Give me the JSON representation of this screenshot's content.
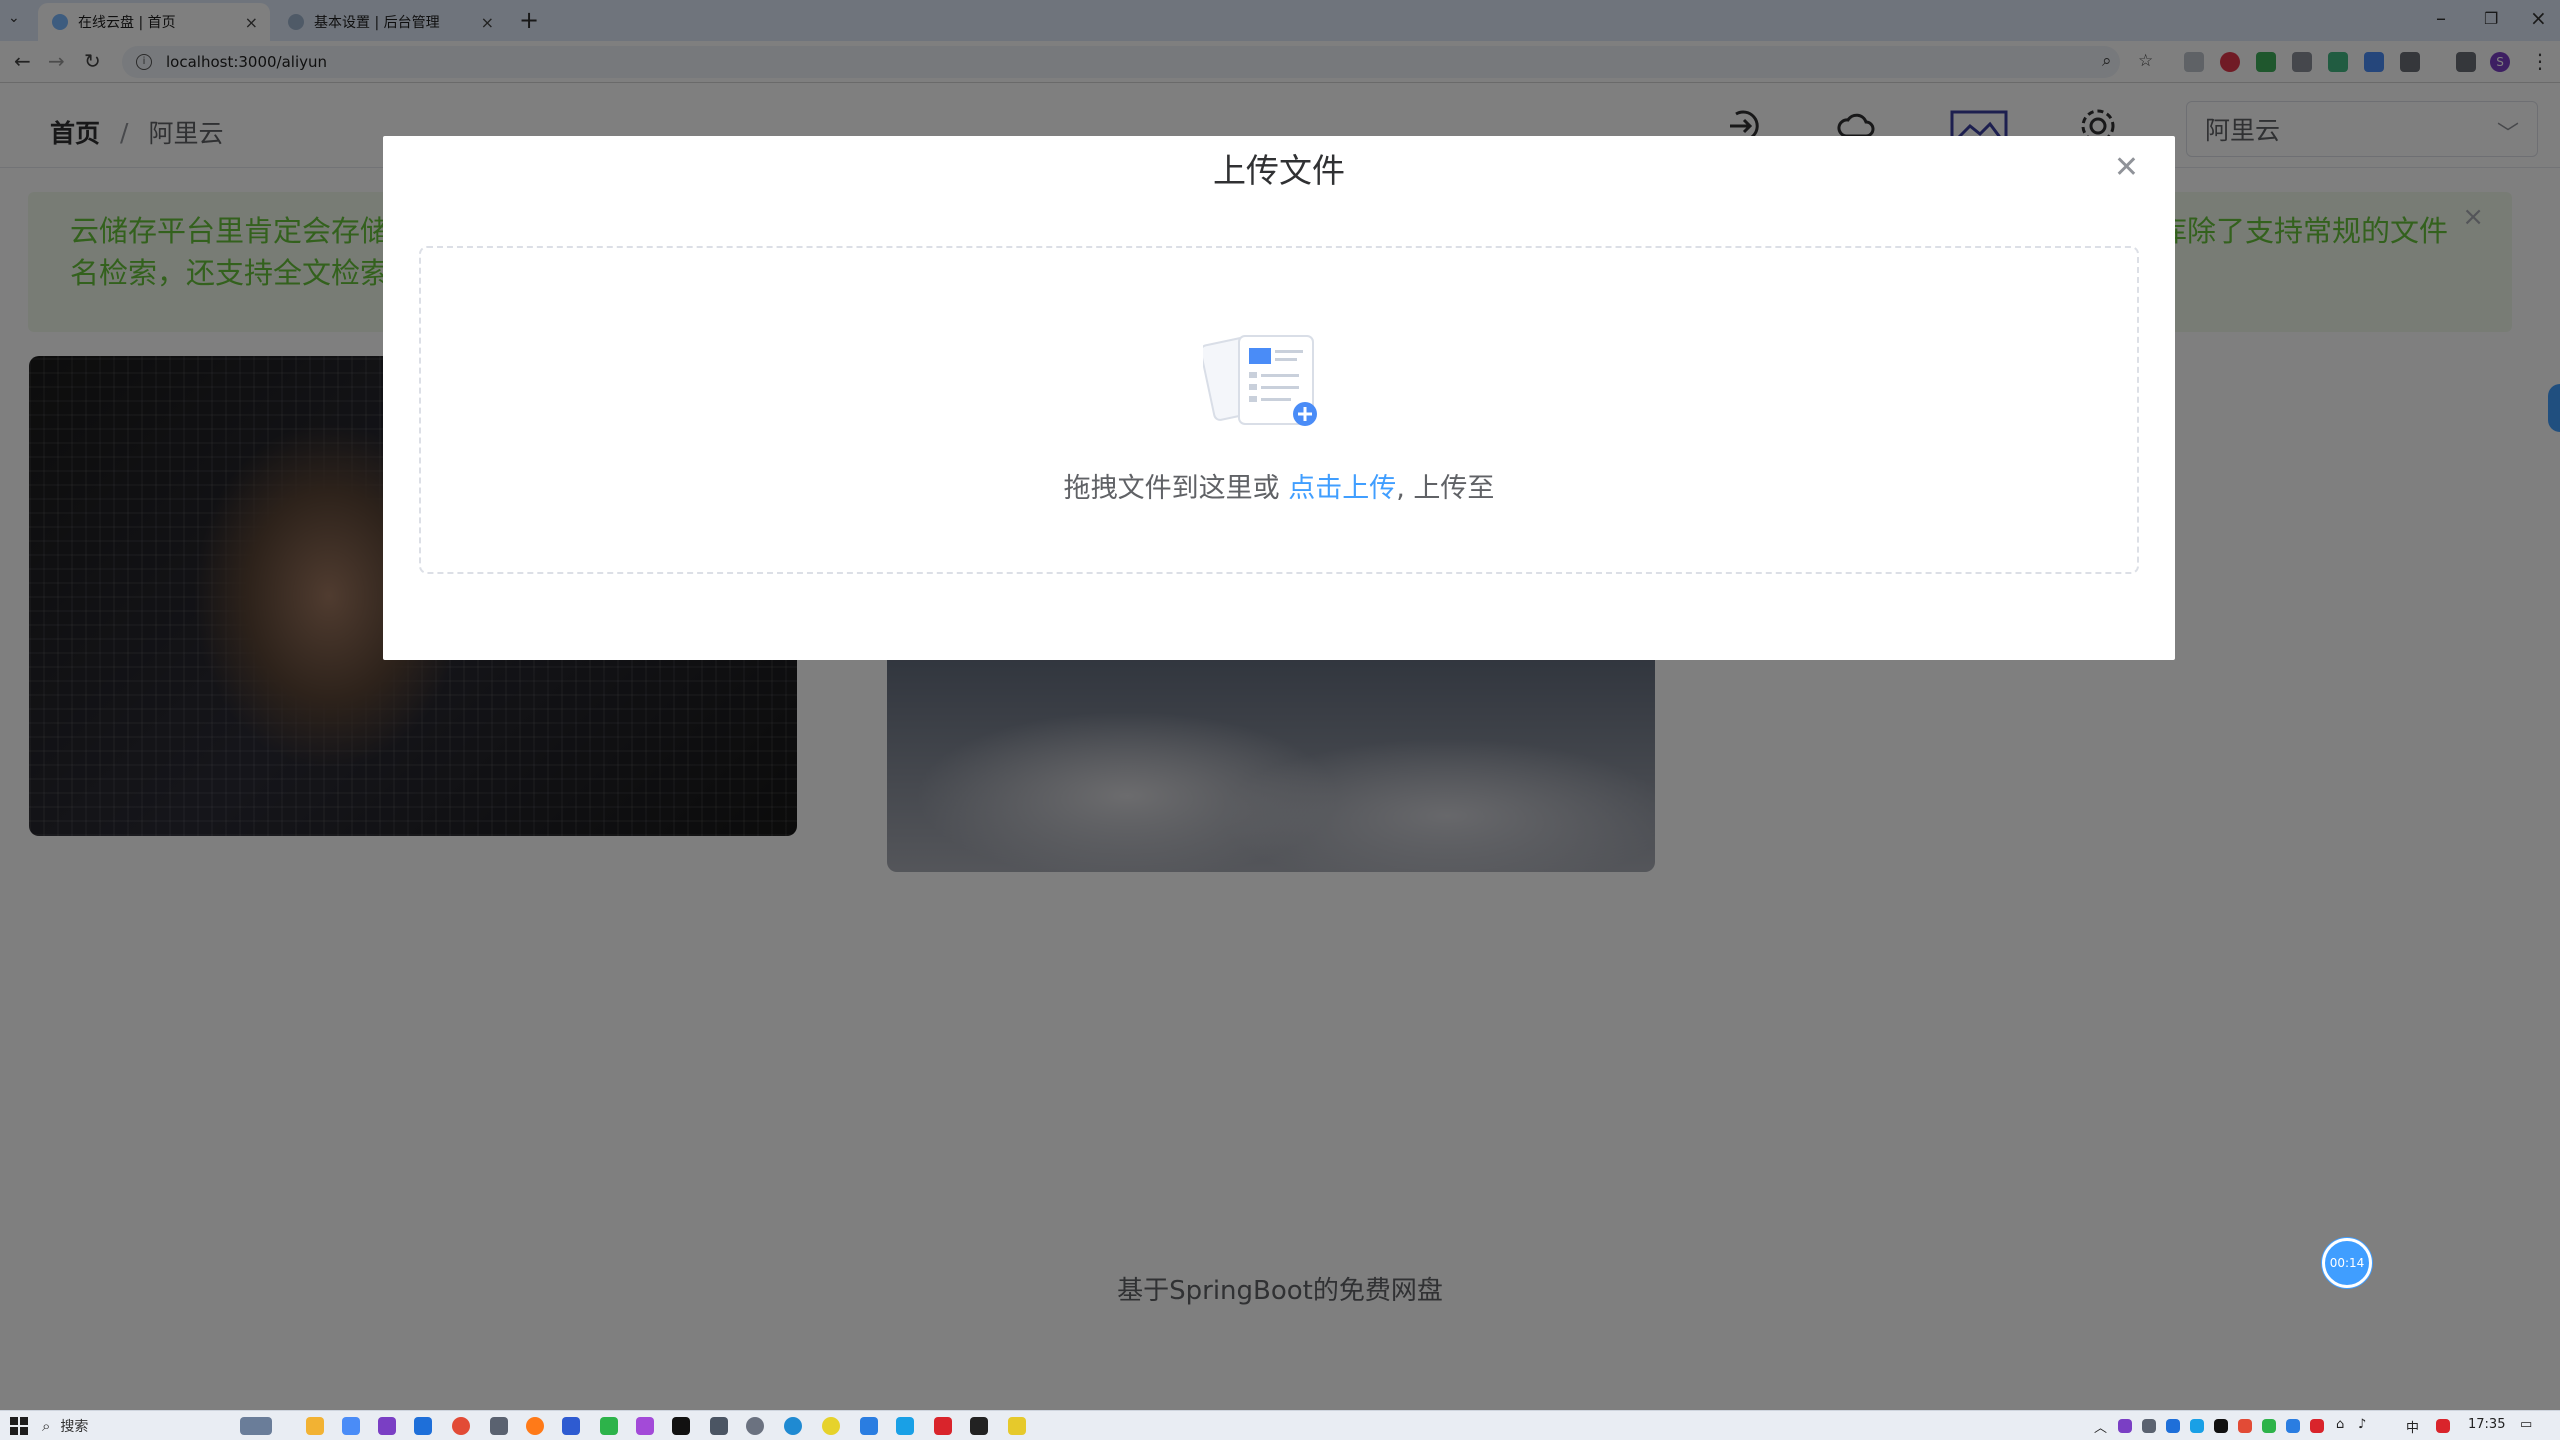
{
  "browser": {
    "tabs": [
      {
        "title": "在线云盘 | 首页",
        "active": true
      },
      {
        "title": "基本设置 | 后台管理",
        "active": false
      }
    ],
    "url": "localhost:3000/aliyun",
    "profile_initial": "S"
  },
  "header": {
    "breadcrumb": {
      "home": "首页",
      "separator": "/",
      "current": "阿里云"
    },
    "icons": [
      "login-icon",
      "cloud-icon",
      "gallery-icon",
      "gear-icon"
    ],
    "provider_select": {
      "value": "阿里云"
    }
  },
  "alert": {
    "text_left": "云储存平台里肯定会存储",
    "text_left_line2": "名检索，还支持全文检索",
    "text_right": "库除了支持常规的文件"
  },
  "dialog": {
    "title": "上传文件",
    "drop_text": "拖拽文件到这里或 ",
    "drop_link": "点击上传",
    "drop_suffix": ", 上传至"
  },
  "footer": {
    "text": "基于SpringBoot的免费网盘"
  },
  "timer": {
    "text": "00:14"
  },
  "taskbar": {
    "search_label": "搜索",
    "ime": "中",
    "time": "17:35"
  },
  "colors": {
    "primary": "#409eff",
    "success_text": "#67c23a",
    "success_bg": "#f0f9eb",
    "overlay": "rgba(0,0,0,0.5)"
  }
}
